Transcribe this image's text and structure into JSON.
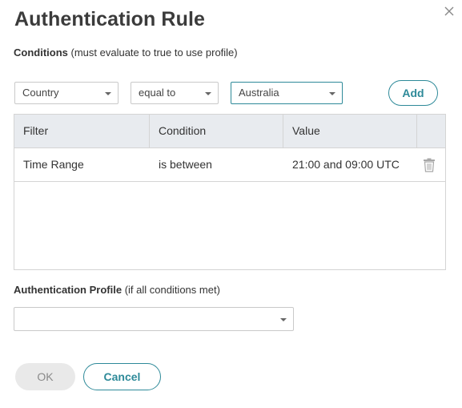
{
  "dialog": {
    "title": "Authentication Rule",
    "close_icon": "close-icon"
  },
  "conditions": {
    "label": "Conditions",
    "hint": "(must evaluate to true to use profile)",
    "filter_select": {
      "value": "Country"
    },
    "operator_select": {
      "value": "equal to"
    },
    "value_select": {
      "value": "Australia"
    },
    "add_label": "Add"
  },
  "table": {
    "columns": [
      "Filter",
      "Condition",
      "Value",
      ""
    ],
    "rows": [
      {
        "filter": "Time Range",
        "condition": "is between",
        "value": "21:00 and 09:00 UTC",
        "action_icon": "trash-icon"
      }
    ]
  },
  "profile": {
    "label": "Authentication Profile",
    "hint": "(if all conditions met)",
    "value": ""
  },
  "footer": {
    "ok_label": "OK",
    "cancel_label": "Cancel"
  },
  "colors": {
    "accent": "#2e8a99",
    "header_bg": "#e8ebef",
    "disabled_bg": "#e9e9e9"
  }
}
